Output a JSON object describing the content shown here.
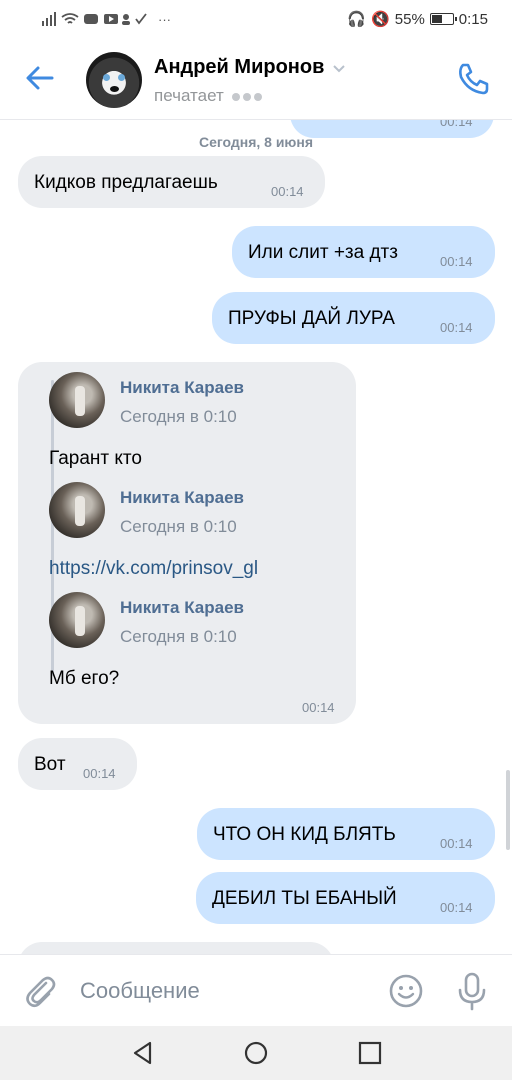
{
  "status": {
    "signal_icons": "signal-wifi-icons",
    "battery_percent": "55%",
    "battery_level": 0.55,
    "time": "0:15"
  },
  "header": {
    "name": "Андрей Миронов",
    "typing": "печатает"
  },
  "chat": {
    "date_separator": "Сегодня, 8 июня",
    "messages": [
      {
        "text": "Кидков предлагаешь",
        "time": "00:14",
        "dir": "in"
      },
      {
        "text": "Или слит +за дтз",
        "time": "00:14",
        "dir": "out"
      },
      {
        "text": "ПРУФЫ ДАЙ ЛУРА",
        "time": "00:14",
        "dir": "out"
      },
      {
        "dir": "in",
        "time": "00:14",
        "forwards": [
          {
            "author": "Никита Караев",
            "date": "Сегодня в 0:10",
            "text": "Гарант кто"
          },
          {
            "author": "Никита Караев",
            "date": "Сегодня в 0:10",
            "text": "https://vk.com/prinsov_gl"
          },
          {
            "author": "Никита Караев",
            "date": "Сегодня в 0:10",
            "text": "Мб его?"
          }
        ]
      },
      {
        "text": "Вот",
        "time": "00:14",
        "dir": "in"
      },
      {
        "text": "ЧТО ОН КИД БЛЯТЬ",
        "time": "00:14",
        "dir": "out"
      },
      {
        "text": "ДЕБИЛ ТЫ ЕБАНЫЙ",
        "time": "00:14",
        "dir": "out"
      }
    ],
    "partial_top_time": "00:14"
  },
  "composer": {
    "placeholder": "Сообщение"
  },
  "colors": {
    "accent": "#3f8ae0",
    "incoming": "#ebedf0",
    "outgoing": "#cce4ff",
    "link": "#2a5885",
    "author": "#4f6e93"
  }
}
